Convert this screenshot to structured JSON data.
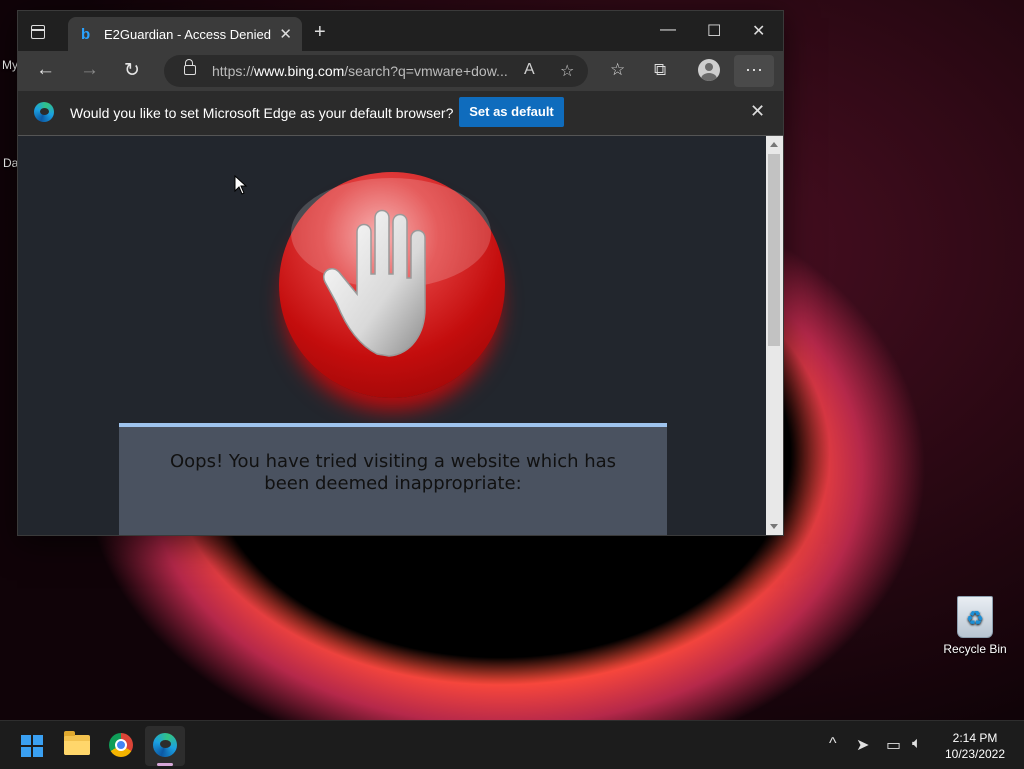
{
  "desktop": {
    "left_labels": [
      "My",
      "Da"
    ],
    "recycle_bin": "Recycle Bin"
  },
  "browser": {
    "tab": {
      "title": "E2Guardian - Access Denied"
    },
    "address": {
      "prefix": "https://",
      "domain": "www.bing.com",
      "path": "/search?q=vmware+dow..."
    },
    "infobar": {
      "message": "Would you like to set Microsoft Edge as your default browser?",
      "button": "Set as default"
    },
    "page": {
      "message": "Oops! You have tried visiting a website which has been deemed inappropriate:"
    }
  },
  "taskbar": {
    "time": "2:14 PM",
    "date": "10/23/2022"
  },
  "colors": {
    "accent": "#0f6cbd",
    "stop_red": "#c40d0d",
    "panel_border": "#9fc4ee"
  }
}
